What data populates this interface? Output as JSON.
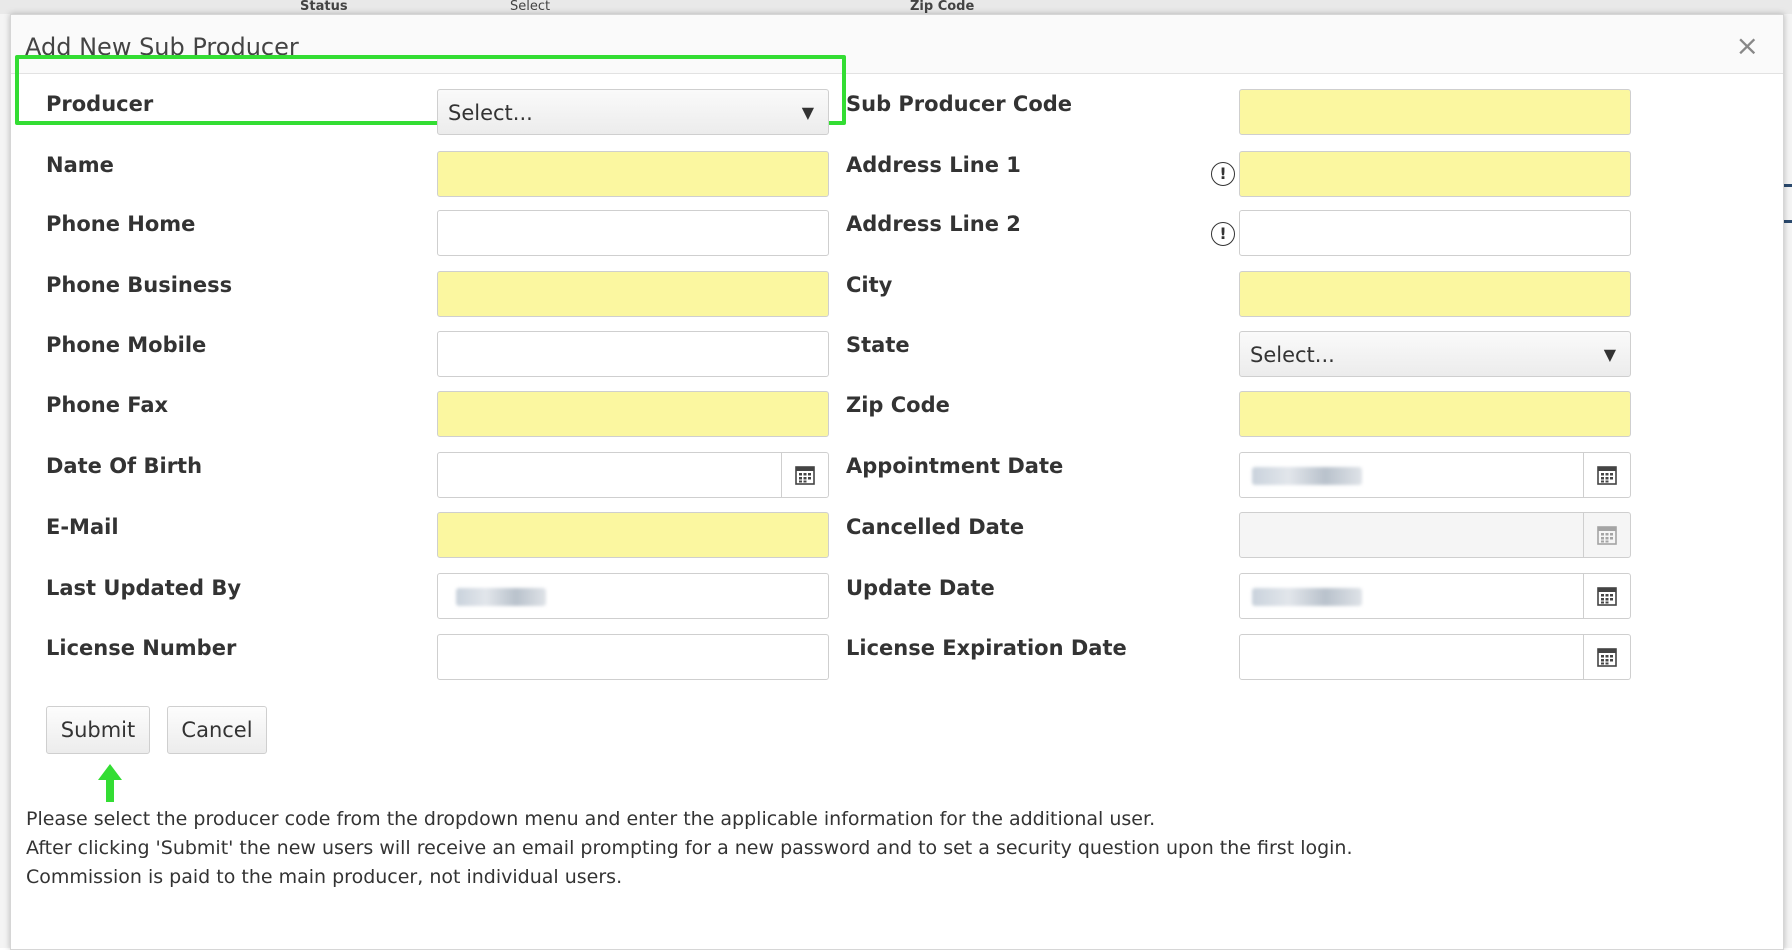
{
  "background": {
    "header_cells": [
      "Status",
      "Select",
      "Zip Code"
    ]
  },
  "modal": {
    "title": "Add New Sub Producer",
    "close_symbol": "×"
  },
  "left_column": {
    "producer": {
      "label": "Producer",
      "value": "Select...",
      "arrow": "▼"
    },
    "name": {
      "label": "Name"
    },
    "phone_home": {
      "label": "Phone Home"
    },
    "phone_business": {
      "label": "Phone Business"
    },
    "phone_mobile": {
      "label": "Phone Mobile"
    },
    "phone_fax": {
      "label": "Phone Fax"
    },
    "date_of_birth": {
      "label": "Date Of Birth"
    },
    "email": {
      "label": "E-Mail"
    },
    "last_updated_by": {
      "label": "Last Updated By"
    },
    "license_number": {
      "label": "License Number"
    }
  },
  "right_column": {
    "sub_producer_code": {
      "label": "Sub Producer Code"
    },
    "address_line_1": {
      "label": "Address Line 1",
      "info_icon": "!"
    },
    "address_line_2": {
      "label": "Address Line 2",
      "info_icon": "!"
    },
    "city": {
      "label": "City"
    },
    "state": {
      "label": "State",
      "value": "Select...",
      "arrow": "▼"
    },
    "zip_code": {
      "label": "Zip Code"
    },
    "appointment_date": {
      "label": "Appointment Date"
    },
    "cancelled_date": {
      "label": "Cancelled Date"
    },
    "update_date": {
      "label": "Update Date"
    },
    "license_expiration_date": {
      "label": "License Expiration Date"
    }
  },
  "buttons": {
    "submit": "Submit",
    "cancel": "Cancel"
  },
  "notes": [
    "Please select the producer code from the dropdown menu and enter the applicable information for the additional user.",
    "After clicking 'Submit' the new users will receive an email prompting for a new password and to set a security question upon the first login.",
    "Commission is paid to the main producer, not individual users."
  ],
  "colors": {
    "required_field": "#fbf7a0",
    "highlight": "#33dd33"
  }
}
